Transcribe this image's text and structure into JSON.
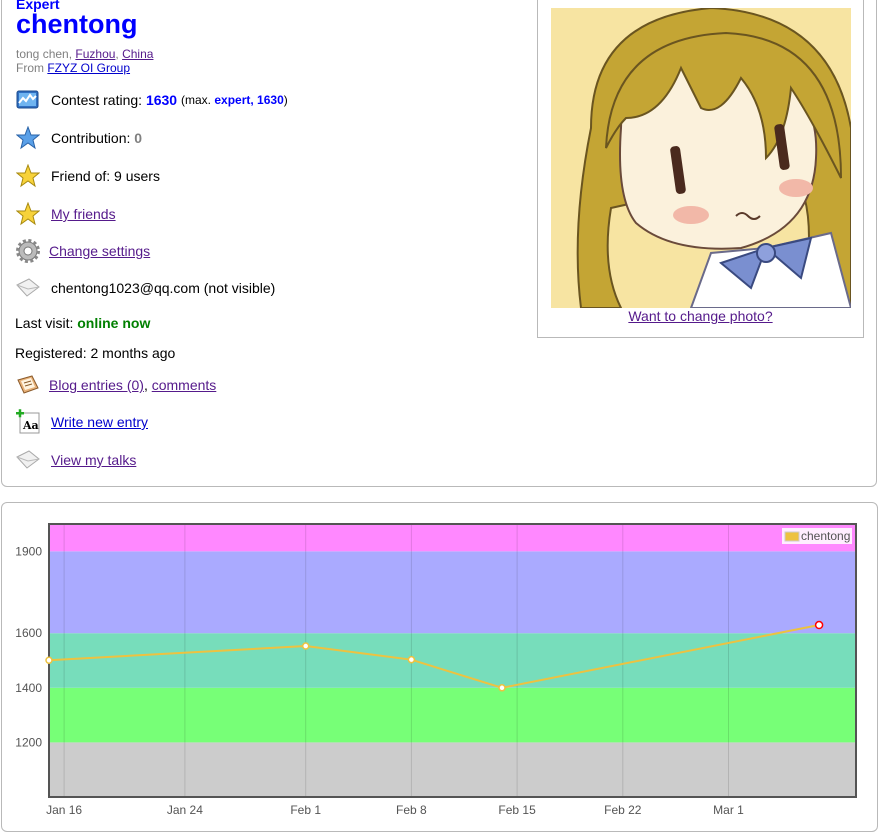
{
  "profile": {
    "rank": "Expert",
    "handle": "chentong",
    "name": "tong chen",
    "city": "Fuzhou",
    "country": "China",
    "from_label": "From",
    "organization": "FZYZ OI Group"
  },
  "rating_row": {
    "label": "Contest rating:",
    "value": "1630",
    "max_prefix": "(max.",
    "max_rank": "expert,",
    "max_value": "1630",
    "max_suffix": ")"
  },
  "contribution_row": {
    "label": "Contribution:",
    "value": "0"
  },
  "friend_row": {
    "text": "Friend of: 9 users"
  },
  "links": {
    "my_friends": "My friends",
    "change_settings": "Change settings",
    "blog_entries": "Blog entries (0)",
    "comments": "comments",
    "write_entry": "Write new entry",
    "view_talks": "View my talks",
    "change_photo": "Want to change photo?"
  },
  "email_row": {
    "text": "chentong1023@qq.com (not visible)"
  },
  "last_visit": {
    "label": "Last visit:",
    "value": "online now"
  },
  "registered": {
    "text": "Registered: 2 months ago"
  },
  "icons": {
    "rating": "rating-chart-icon",
    "contribution": "blue-star-icon",
    "friends": "gold-star-icon",
    "my_friends": "gold-star-icon",
    "settings": "gear-icon",
    "email": "envelope-icon",
    "blog": "blog-book-icon",
    "write": "write-entry-icon",
    "talks": "envelope-icon"
  },
  "colors": {
    "handle_blue": "#0000ff",
    "online_green": "#008000",
    "line_color": "#edc240",
    "band_candidate_master": "#ff88ff",
    "band_expert": "#aaaaff",
    "band_specialist": "#77ddbb",
    "band_pupil": "#77ff77",
    "band_newbie": "#cccccc"
  },
  "chart_data": {
    "type": "line",
    "series": [
      {
        "name": "chentong",
        "points": [
          {
            "x": "Jan 15",
            "y": 1501
          },
          {
            "x": "Feb 1",
            "y": 1553
          },
          {
            "x": "Feb 8",
            "y": 1503
          },
          {
            "x": "Feb 14",
            "y": 1400
          },
          {
            "x": "Mar 7",
            "y": 1630
          }
        ]
      }
    ],
    "x_ticks": [
      "Jan 16",
      "Jan 24",
      "Feb 1",
      "Feb 8",
      "Feb 15",
      "Feb 22",
      "Mar 1"
    ],
    "y_ticks": [
      "1200",
      "1400",
      "1600",
      "1900"
    ],
    "ylim": [
      1000,
      2000
    ],
    "bands": [
      {
        "from": 1000,
        "to": 1200,
        "color": "#cccccc"
      },
      {
        "from": 1200,
        "to": 1400,
        "color": "#77ff77"
      },
      {
        "from": 1400,
        "to": 1600,
        "color": "#77ddbb"
      },
      {
        "from": 1600,
        "to": 1900,
        "color": "#aaaaff"
      },
      {
        "from": 1900,
        "to": 2000,
        "color": "#ff88ff"
      }
    ],
    "grid": true,
    "legend": "top-right",
    "title": "",
    "xlabel": "",
    "ylabel": ""
  }
}
